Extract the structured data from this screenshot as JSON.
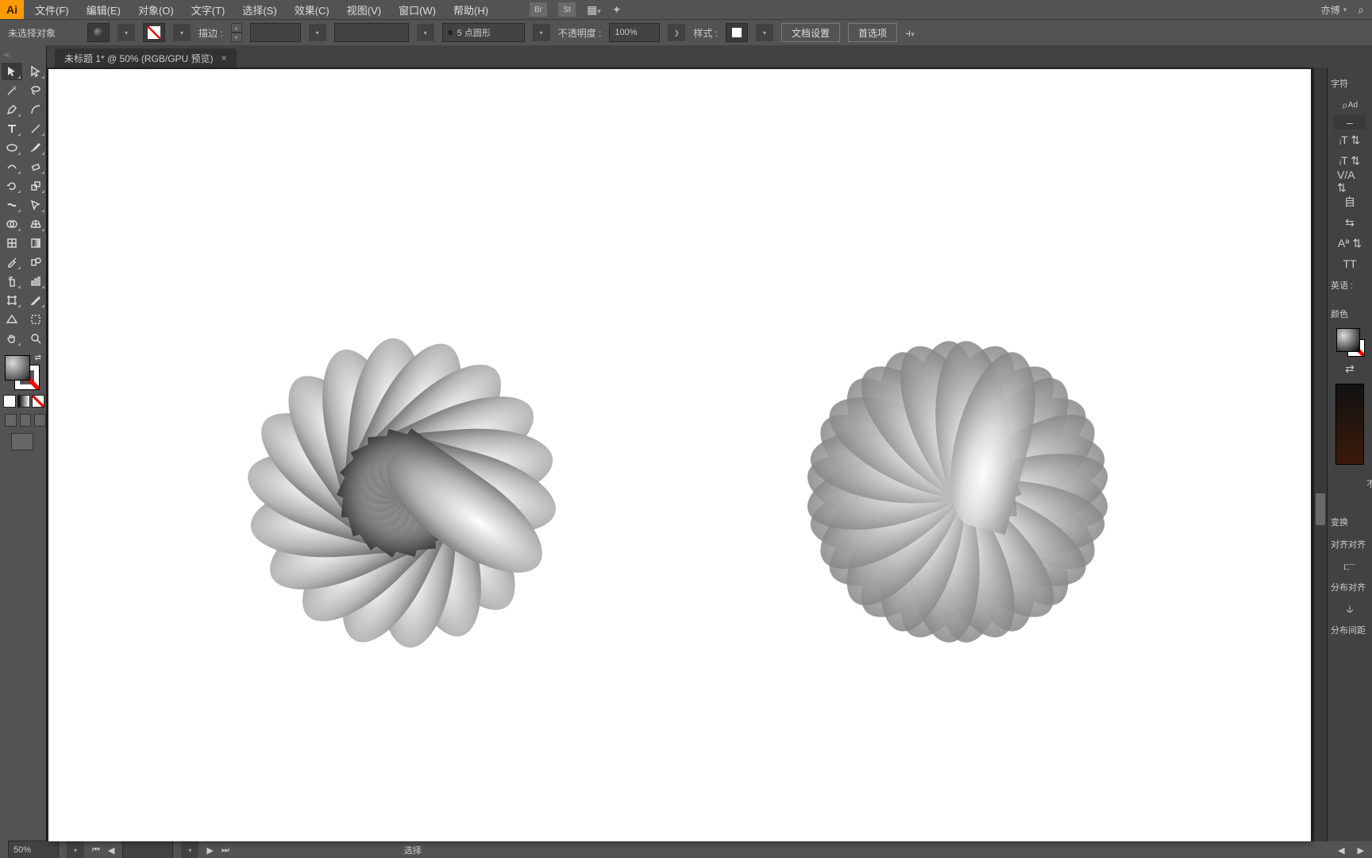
{
  "app_logo": "Ai",
  "menus": [
    "文件(F)",
    "编辑(E)",
    "对象(O)",
    "文字(T)",
    "选择(S)",
    "效果(C)",
    "视图(V)",
    "窗口(W)",
    "帮助(H)"
  ],
  "menu_right_icons": [
    "Br",
    "St"
  ],
  "workspace_label": "亦博",
  "search_icon": "⌕",
  "optbar": {
    "selection": "未选择对象",
    "stroke_label": "描边 :",
    "stroke_weight": "",
    "stroke_profile": "5 点圆形",
    "opacity_label": "不透明度 :",
    "opacity_value": "100%",
    "style_label": "样式 :",
    "doc_setup": "文档设置",
    "preferences": "首选项"
  },
  "tab": {
    "title": "未标题 1* @ 50% (RGB/GPU 预览)"
  },
  "tools": [
    "selection",
    "direct-selection",
    "magic-wand",
    "lasso",
    "pen",
    "curvature",
    "type",
    "line",
    "rectangle",
    "paintbrush",
    "shaper",
    "eraser",
    "rotate",
    "scale",
    "width",
    "free-transform",
    "shape-builder",
    "perspective",
    "mesh",
    "gradient",
    "eyedropper",
    "blend",
    "symbol-sprayer",
    "column-graph",
    "artboard",
    "slice",
    "perspective-selection",
    "print-tiling",
    "hand",
    "zoom"
  ],
  "right_panel": {
    "char_group": "字符",
    "search_label": "Ad",
    "typeface": "",
    "size_ctrl": "IT",
    "leading": "IT",
    "kerning": "VA",
    "tracking": "自",
    "vscale": "",
    "baseline": "",
    "chars": "TT",
    "lang": "英语 :",
    "color_title": "颜色",
    "swap": "⇄",
    "transform_title": "变换",
    "align_title": "对齐对齐",
    "distribute_title": "分布对齐",
    "distribute_spacing": "分布间距",
    "opacity_missing": "不"
  },
  "status": {
    "zoom": "50%",
    "tool": "选择"
  }
}
